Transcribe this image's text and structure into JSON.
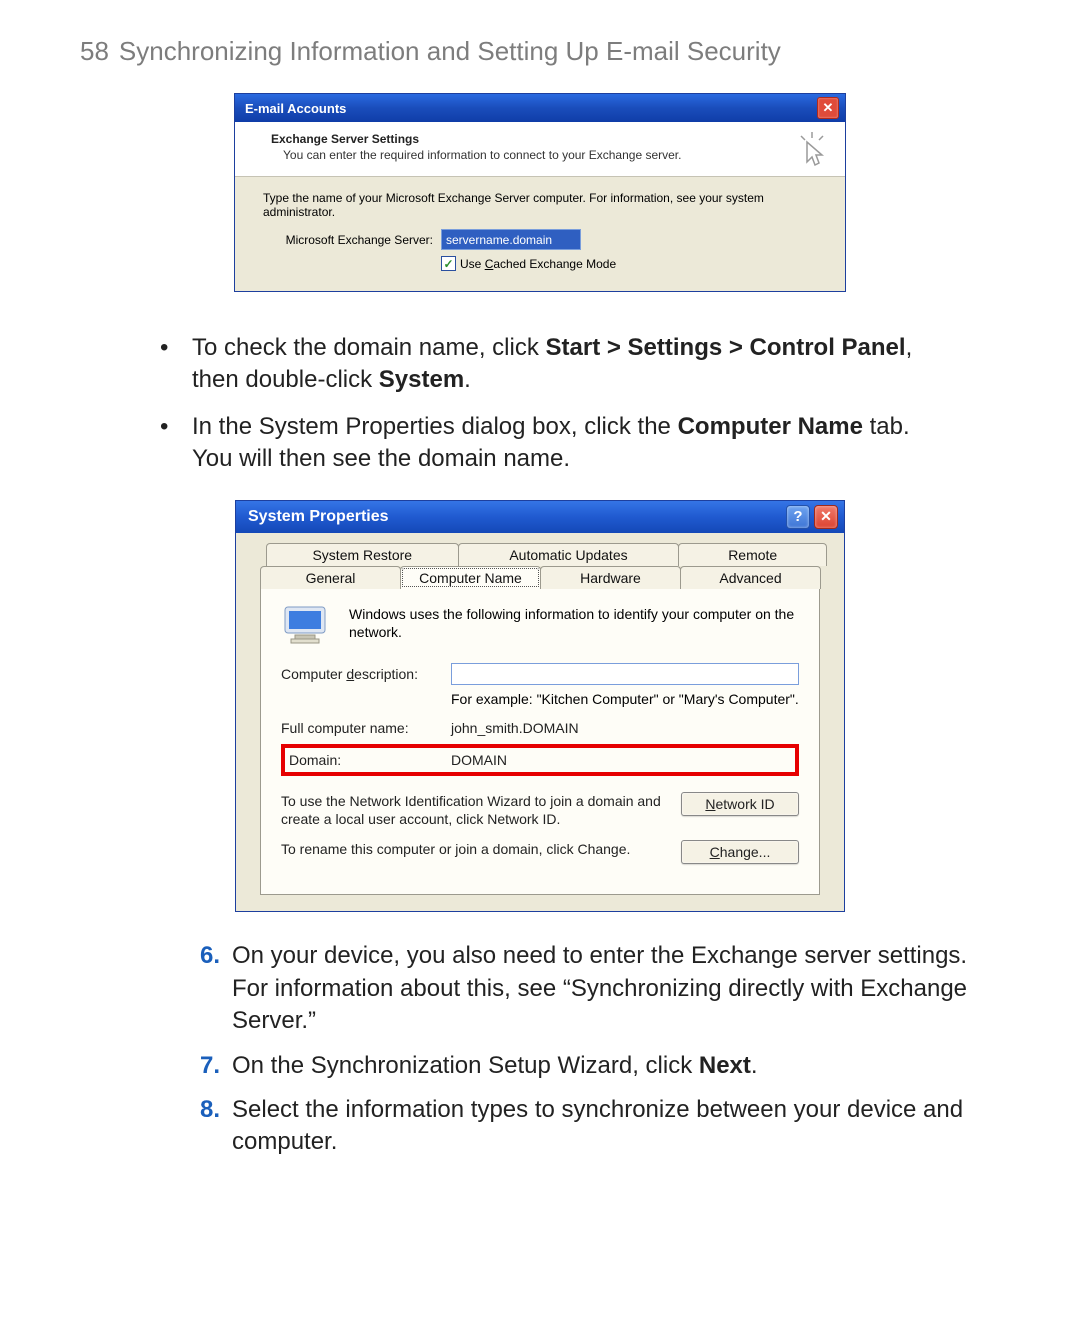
{
  "header": {
    "pageNumber": "58",
    "title": "Synchronizing Information and Setting Up E-mail Security"
  },
  "emailDialog": {
    "title": "E-mail Accounts",
    "headTitle": "Exchange Server Settings",
    "headSub": "You can enter the required information to connect to your Exchange server.",
    "instr": "Type the name of your Microsoft Exchange Server computer. For information, see your system administrator.",
    "serverLabel": "Microsoft Exchange Server:",
    "serverValue": "servername.domain",
    "cachedLabel": "Use Cached Exchange Mode"
  },
  "bullets": {
    "b1_a": "To check the domain name, click ",
    "b1_bold1": "Start > Settings > Control Panel",
    "b1_mid": ", then double-click ",
    "b1_bold2": "System",
    "b1_end": ".",
    "b2_a": "In the System Properties dialog box, click the ",
    "b2_bold": "Computer Name",
    "b2_end": " tab. You will then see the domain name."
  },
  "sysProp": {
    "title": "System Properties",
    "tabs": {
      "systemRestore": "System Restore",
      "autoUpdates": "Automatic Updates",
      "remote": "Remote",
      "general": "General",
      "computerName": "Computer Name",
      "hardware": "Hardware",
      "advanced": "Advanced"
    },
    "info": "Windows uses the following information to identify your computer on the network.",
    "descLabel": "Computer description:",
    "hint": "For example: \"Kitchen Computer\" or \"Mary's Computer\".",
    "fullLabel": "Full computer name:",
    "fullValue": "john_smith.DOMAIN",
    "domainLabel": "Domain:",
    "domainValue": "DOMAIN",
    "networkIdText": "To use the Network Identification Wizard to join a domain and create a local user account, click Network ID.",
    "networkIdBtn_pre": "N",
    "networkIdBtn_rest": "etwork ID",
    "changeText": "To rename this computer or join a domain, click Change.",
    "changeBtn_pre": "C",
    "changeBtn_rest": "hange..."
  },
  "numbered": {
    "n6_num": "6.",
    "n6_text": "On your device, you also need to enter the Exchange server settings. For information about this, see “Synchronizing directly with Exchange Server.”",
    "n7_num": "7.",
    "n7_a": "On the Synchronization Setup Wizard, click ",
    "n7_bold": "Next",
    "n7_end": ".",
    "n8_num": "8.",
    "n8_text": "Select the information types to synchronize between your device and computer."
  }
}
